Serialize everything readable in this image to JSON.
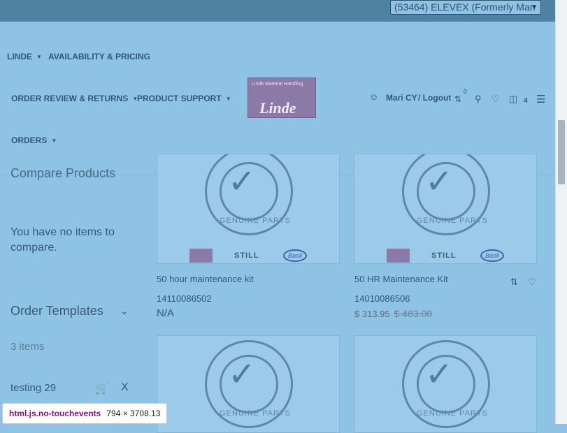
{
  "account": {
    "selected": "(53464) ELEVEX (Formerly Man"
  },
  "nav": [
    {
      "label": "LINDE",
      "has_chevron": true
    },
    {
      "label": "AVAILABILITY & PRICING",
      "has_chevron": false
    },
    {
      "label": "ORDER REVIEW & RETURNS",
      "has_chevron": true
    },
    {
      "label": "PRODUCT SUPPORT",
      "has_chevron": true
    },
    {
      "label": "ORDERS",
      "has_chevron": true
    }
  ],
  "logo": {
    "tagline": "Linde Material Handling",
    "word": "Linde"
  },
  "user": {
    "name": "Mari CY",
    "logout": "/ Logout",
    "compare_count": "0",
    "cart_count": "4"
  },
  "sidebar": {
    "compare_title": "Compare Products",
    "compare_empty": "You have no items to compare.",
    "templates_title": "Order Templates",
    "templates_count": "3 items",
    "template_item": "testing 29",
    "remove": "X"
  },
  "seal": {
    "text": "GENUINE PARTS",
    "top_text": "Linde · STILL · Baoli"
  },
  "brands": {
    "still": "STILL",
    "baoli": "Baoli"
  },
  "products": [
    {
      "name": "50 hour maintenance kit",
      "sku": "14110086502",
      "price": "N/A"
    },
    {
      "name": "50 HR Maintenance Kit",
      "sku": "14010086506",
      "price": "$ 313.95",
      "old_price": "$ 483.00"
    }
  ],
  "devtools": {
    "class": "html.js.no-touchevents",
    "size": "794 × 3708.13"
  },
  "colors": {
    "overlay": "#8ec3e6",
    "topbar": "#4f81a3",
    "linde": "#8b7aa7"
  }
}
